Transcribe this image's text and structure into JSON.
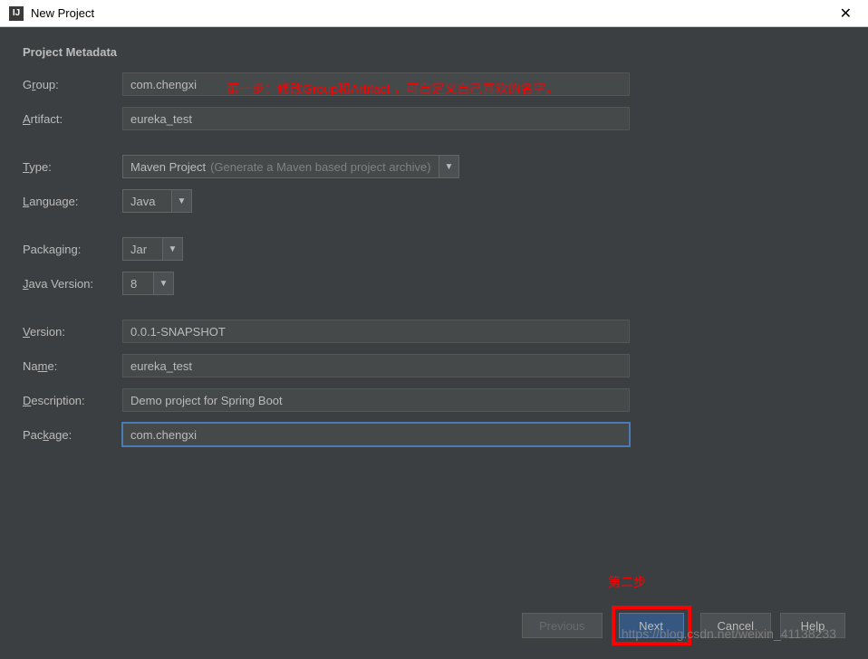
{
  "titlebar": {
    "title": "New Project"
  },
  "section": {
    "header": "Project Metadata"
  },
  "annotations": {
    "step1": "第一步：修改Group和Artifact ，可自定义自己喜欢的名字。",
    "step2": "第二步"
  },
  "fields": {
    "group": {
      "label_pre": "G",
      "label_u": "r",
      "label_post": "oup:",
      "value": "com.chengxi"
    },
    "artifact": {
      "label_pre": "",
      "label_u": "A",
      "label_post": "rtifact:",
      "value": "eureka_test"
    },
    "type": {
      "label_pre": "",
      "label_u": "T",
      "label_post": "ype:",
      "value": "Maven Project",
      "desc": "(Generate a Maven based project archive)"
    },
    "language": {
      "label_pre": "",
      "label_u": "L",
      "label_post": "anguage:",
      "value": "Java"
    },
    "packaging": {
      "label_pre": "Packagin",
      "label_u": "g",
      "label_post": ":",
      "value": "Jar"
    },
    "javaVersion": {
      "label_pre": "",
      "label_u": "J",
      "label_post": "ava Version:",
      "value": "8"
    },
    "version": {
      "label_pre": "",
      "label_u": "V",
      "label_post": "ersion:",
      "value": "0.0.1-SNAPSHOT"
    },
    "name": {
      "label_pre": "Na",
      "label_u": "m",
      "label_post": "e:",
      "value": "eureka_test"
    },
    "description": {
      "label_pre": "",
      "label_u": "D",
      "label_post": "escription:",
      "value": "Demo project for Spring Boot"
    },
    "package": {
      "label_pre": "Pac",
      "label_u": "k",
      "label_post": "age:",
      "value": "com.chengxi"
    }
  },
  "buttons": {
    "previous": "Previous",
    "next": "Next",
    "cancel": "Cancel",
    "help": "Help"
  },
  "watermark": "https://blog.csdn.net/weixin_41138233"
}
